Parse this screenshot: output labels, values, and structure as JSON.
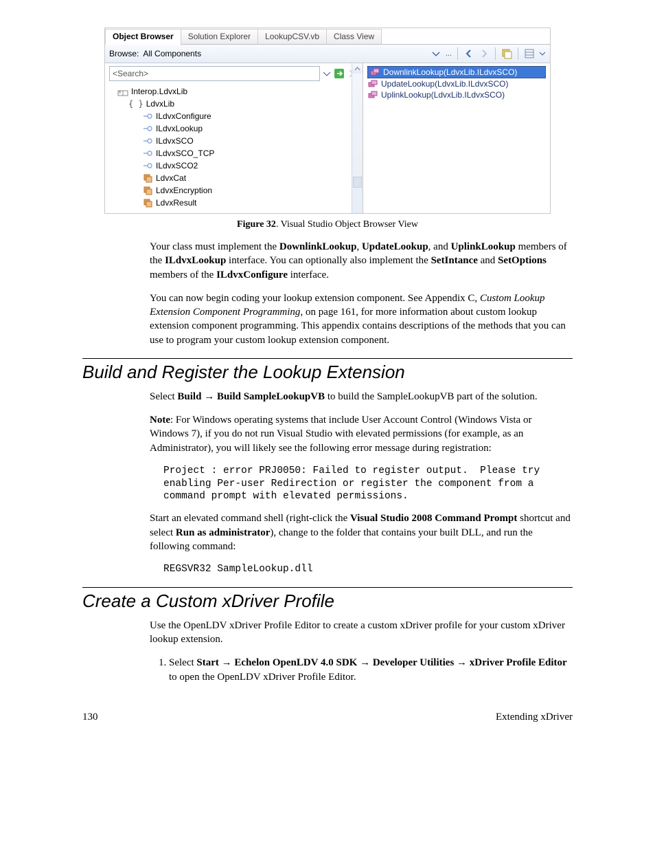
{
  "object_browser": {
    "tabs": [
      "Object Browser",
      "Solution Explorer",
      "LookupCSV.vb",
      "Class View"
    ],
    "browse_label": "Browse:",
    "browse_value": "All Components",
    "search_placeholder": "<Search>",
    "tree": {
      "root": "Interop.LdvxLib",
      "ns": "LdvxLib",
      "interfaces": [
        "ILdvxConfigure",
        "ILdvxLookup",
        "ILdvxSCO",
        "ILdvxSCO_TCP",
        "ILdvxSCO2"
      ],
      "classes": [
        "LdvxCat",
        "LdvxEncryption",
        "LdvxResult"
      ]
    },
    "members": {
      "m0": "DownlinkLookup(LdvxLib.ILdvxSCO)",
      "m1": "UpdateLookup(LdvxLib.ILdvxSCO)",
      "m2": "UplinkLookup(LdvxLib.ILdvxSCO)"
    }
  },
  "fig_caption_bold": "Figure 32",
  "fig_caption_rest": ". Visual Studio Object Browser View",
  "p1_a": "Your class must implement the ",
  "p1_b": "DownlinkLookup",
  "p1_c": ", ",
  "p1_d": "UpdateLookup",
  "p1_e": ", and ",
  "p1_f": "UplinkLookup",
  "p1_g": " members of the ",
  "p1_h": "ILdvxLookup",
  "p1_i": " interface.  You can optionally also implement the ",
  "p1_j": "SetIntance",
  "p1_k": " and ",
  "p1_l": "SetOptions",
  "p1_m": " members of the ",
  "p1_n": "ILdvxConfigure",
  "p1_o": " interface.",
  "p2_a": "You can now begin coding your lookup extension component.  See Appendix C, ",
  "p2_b": "Custom Lookup Extension Component Programming",
  "p2_c": ", on page 161, for more information about custom lookup extension component programming.  This appendix contains descriptions of the methods that you can use to program your custom lookup extension component.",
  "h_build": "Build and Register the Lookup Extension",
  "p3_a": "Select ",
  "p3_b": "Build",
  "p3_c": " → ",
  "p3_d": "Build SampleLookupVB",
  "p3_e": " to build the SampleLookupVB part of the solution.",
  "p4_a": "Note",
  "p4_b": ":  For Windows operating systems that include User Account Control (Windows Vista or Windows 7), if you do not run Visual Studio with elevated permissions (for example, as an Administrator), you will likely see the following error message during registration:",
  "code1": "Project : error PRJ0050: Failed to register output.  Please try enabling Per-user Redirection or register the component from a command prompt with elevated permissions.",
  "p5_a": "Start an elevated command shell (right-click the ",
  "p5_b": "Visual Studio 2008 Command Prompt",
  "p5_c": " shortcut and select ",
  "p5_d": "Run as administrator",
  "p5_e": "), change to the folder that contains your built DLL, and run the following command:",
  "code2": "REGSVR32 SampleLookup.dll",
  "h_create": "Create a Custom xDriver Profile",
  "p6": "Use the OpenLDV xDriver Profile Editor to create a custom xDriver profile for your custom xDriver lookup extension.",
  "step1_a": "Select ",
  "step1_b": "Start",
  "step1_c": " → ",
  "step1_d": "Echelon OpenLDV 4.0 SDK",
  "step1_e": " → ",
  "step1_f": "Developer Utilities",
  "step1_g": " → ",
  "step1_h": "xDriver Profile Editor",
  "step1_i": " to open the OpenLDV xDriver Profile Editor.",
  "footer_left": "130",
  "footer_right": "Extending xDriver"
}
